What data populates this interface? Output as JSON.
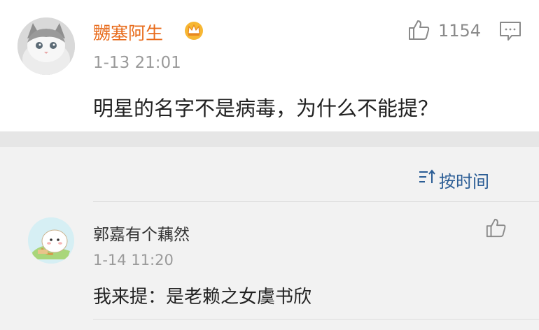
{
  "post": {
    "username": "嬲塞阿生",
    "time": "1-13 21:01",
    "text": "明星的名字不是病毒，为什么不能提？",
    "like_count": "1154",
    "avatar_icon": "cat-avatar",
    "badge_icon": "crown-icon"
  },
  "sort": {
    "label": "按时间",
    "icon": "sort-icon"
  },
  "reply": {
    "username": "郭嘉有个藕然",
    "time": "1-14 11:20",
    "text": "我来提：是老赖之女虞书欣",
    "avatar_icon": "cartoon-avatar"
  },
  "colors": {
    "username_accent": "#e86b1b",
    "sort_link": "#2b5d95",
    "muted_text": "#9a9a9a",
    "body_text": "#222222"
  }
}
